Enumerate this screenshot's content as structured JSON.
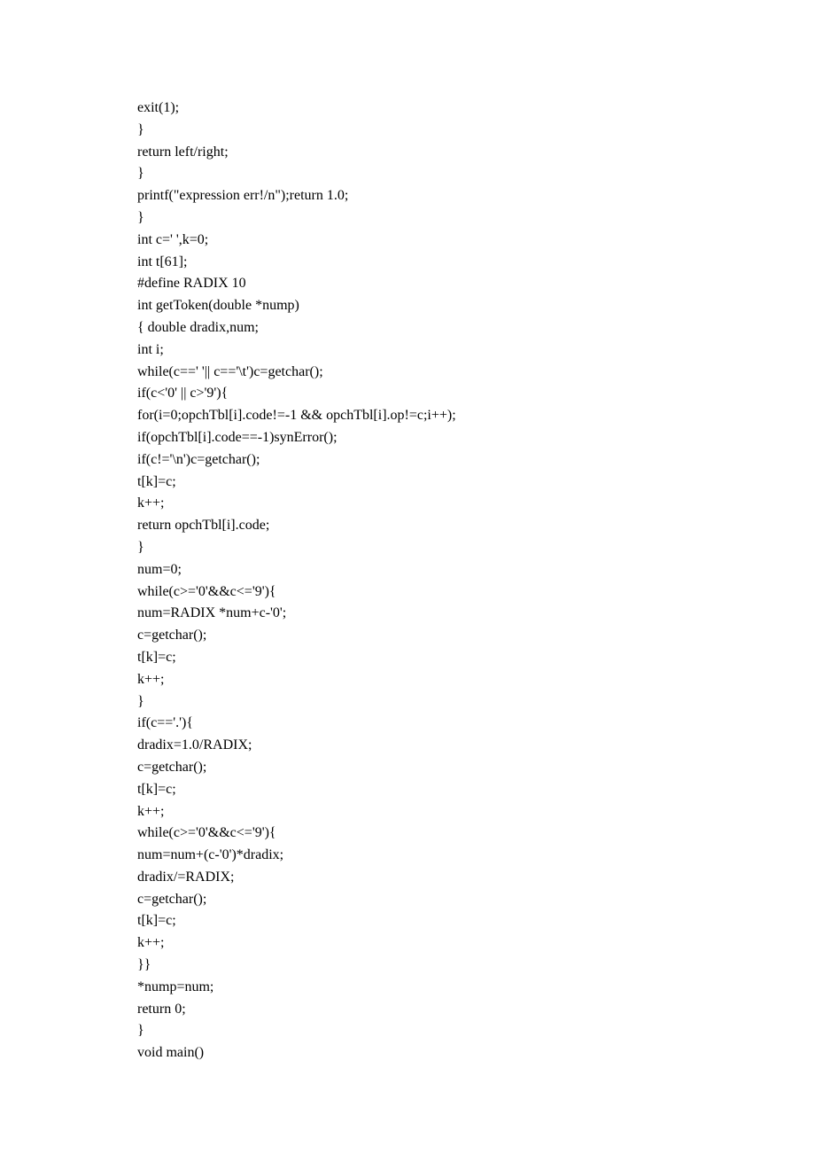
{
  "code_lines": [
    "exit(1);",
    "}",
    "return left/right;",
    "}",
    "printf(\"expression err!/n\");return 1.0;",
    "}",
    "int c=' ',k=0;",
    "int t[61];",
    "#define RADIX 10",
    "int getToken(double *nump)",
    "{ double dradix,num;",
    "int i;",
    "while(c==' '|| c=='\\t')c=getchar();",
    "if(c<'0' || c>'9'){",
    "for(i=0;opchTbl[i].code!=-1 && opchTbl[i].op!=c;i++);",
    "if(opchTbl[i].code==-1)synError();",
    "if(c!='\\n')c=getchar();",
    "t[k]=c;",
    "k++;",
    "return opchTbl[i].code;",
    "}",
    "num=0;",
    "while(c>='0'&&c<='9'){",
    "num=RADIX *num+c-'0';",
    "c=getchar();",
    "t[k]=c;",
    "k++;",
    "}",
    "if(c=='.'){",
    "dradix=1.0/RADIX;",
    "c=getchar();",
    "t[k]=c;",
    "k++;",
    "while(c>='0'&&c<='9'){",
    "num=num+(c-'0')*dradix;",
    "dradix/=RADIX;",
    "c=getchar();",
    "t[k]=c;",
    "k++;",
    "}}",
    "*nump=num;",
    "return 0;",
    "}",
    "void main()"
  ]
}
